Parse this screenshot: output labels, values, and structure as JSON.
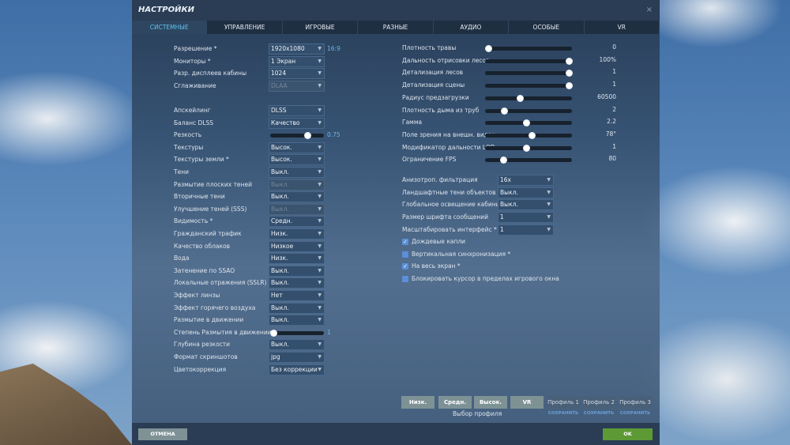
{
  "window": {
    "title": "НАСТРОЙКИ",
    "close": "×"
  },
  "tabs": [
    "СИСТЕМНЫЕ",
    "УПРАВЛЕНИЕ",
    "ИГРОВЫЕ",
    "РАЗНЫЕ",
    "АУДИО",
    "ОСОБЫЕ",
    "VR"
  ],
  "active_tab": "СИСТЕМНЫЕ",
  "left_settings": [
    {
      "label": "Разрешение *",
      "type": "select",
      "value": "1920x1080",
      "extra": "16:9"
    },
    {
      "label": "Мониторы *",
      "type": "select",
      "value": "1 Экран"
    },
    {
      "label": "Разр. дисплеев кабины",
      "type": "select",
      "value": "1024"
    },
    {
      "label": "Сглаживание",
      "type": "select",
      "value": "DLAA",
      "disabled": true
    },
    null,
    {
      "label": "Апскейлинг",
      "type": "select",
      "value": "DLSS"
    },
    {
      "label": "Баланс DLSS",
      "type": "select",
      "value": "Качество"
    },
    {
      "label": "Резкость",
      "type": "slider",
      "value": "0.75",
      "level": 0.72
    },
    {
      "label": "Текстуры",
      "type": "select",
      "value": "Высок."
    },
    {
      "label": "Текстуры земли *",
      "type": "select",
      "value": "Высок."
    },
    {
      "label": "Тени",
      "type": "select",
      "value": "Выкл."
    },
    {
      "label": "Размытие плоских теней",
      "type": "select",
      "value": "Выкл.",
      "disabled": true
    },
    {
      "label": "Вторичные тени",
      "type": "select",
      "value": "Выкл."
    },
    {
      "label": "Улучшение теней (SSS)",
      "type": "select",
      "value": "Выкл.",
      "disabled": true
    },
    {
      "label": "Видимость *",
      "type": "select",
      "value": "Средн."
    },
    {
      "label": "Гражданский трафик",
      "type": "select",
      "value": "Низк."
    },
    {
      "label": "Качество облаков",
      "type": "select",
      "value": "Низкое"
    },
    {
      "label": "Вода",
      "type": "select",
      "value": "Низк."
    },
    {
      "label": "Затенение по SSAO",
      "type": "select",
      "value": "Выкл."
    },
    {
      "label": "Локальные отражения (SSLR)",
      "type": "select",
      "value": "Выкл."
    },
    {
      "label": "Эффект линзы",
      "type": "select",
      "value": "Нет"
    },
    {
      "label": "Эффект горячего воздуха",
      "type": "select",
      "value": "Выкл."
    },
    {
      "label": "Размытие в движении",
      "type": "select",
      "value": "Выкл."
    },
    {
      "label": "Степень Размытия в движении",
      "type": "slider",
      "value": "1",
      "level": 0
    },
    {
      "label": "Глубина резкости",
      "type": "select",
      "value": "Выкл."
    },
    {
      "label": "Формат скриншотов",
      "type": "select",
      "value": "jpg"
    },
    {
      "label": "Цветокоррекция",
      "type": "select",
      "value": "Без коррекции"
    }
  ],
  "right_sliders": [
    {
      "label": "Плотность травы",
      "value": "0",
      "level": 0
    },
    {
      "label": "Дальность отрисовки лесов",
      "value": "100%",
      "level": 1
    },
    {
      "label": "Детализация лесов",
      "value": "1",
      "level": 1
    },
    {
      "label": "Детализация сцены",
      "value": "1",
      "level": 1
    },
    {
      "label": "Радиус предзагрузки",
      "value": "60500",
      "level": 0.4
    },
    {
      "label": "Плотность дыма из труб",
      "value": "2",
      "level": 0.2
    },
    {
      "label": "Гамма",
      "value": "2.2",
      "level": 0.48
    },
    {
      "label": "Поле зрения на внешн. видах",
      "value": "78°",
      "level": 0.54
    },
    {
      "label": "Модификатор дальности LOD",
      "value": "1",
      "level": 0.48
    },
    {
      "label": "Ограничение FPS",
      "value": "80",
      "level": 0.19
    }
  ],
  "right_selects": [
    {
      "label": "Анизотроп. фильтрация",
      "value": "16x"
    },
    {
      "label": "Ландшафтные тени объектов",
      "value": "Выкл."
    },
    {
      "label": "Глобальное освещение кабины",
      "value": "Выкл."
    },
    {
      "label": "Размер шрифта сообщений",
      "value": "1"
    },
    {
      "label": "Масштабировать интерфейс *",
      "value": "1"
    }
  ],
  "checkboxes": [
    {
      "label": "Дождевые капли",
      "checked": true
    },
    {
      "label": "Вертикальная синхронизация *",
      "checked": false
    },
    {
      "label": "На весь экран *",
      "checked": true
    },
    {
      "label": "Блокировать курсор в пределах игрового окна",
      "checked": false
    }
  ],
  "presets": [
    "Низк.",
    "Средн.",
    "Высок.",
    "VR"
  ],
  "preset_caption": "Выбор профиля",
  "profiles": [
    "Профиль 1",
    "Профиль 2",
    "Профиль 3"
  ],
  "save_label": "СОХРАНИТЬ",
  "footer": {
    "cancel": "ОТМЕНА",
    "ok": "OK"
  },
  "colors": {
    "accent": "#5fc4ec",
    "ok": "#5d9a36",
    "checkbox": "#5b8fd8"
  }
}
